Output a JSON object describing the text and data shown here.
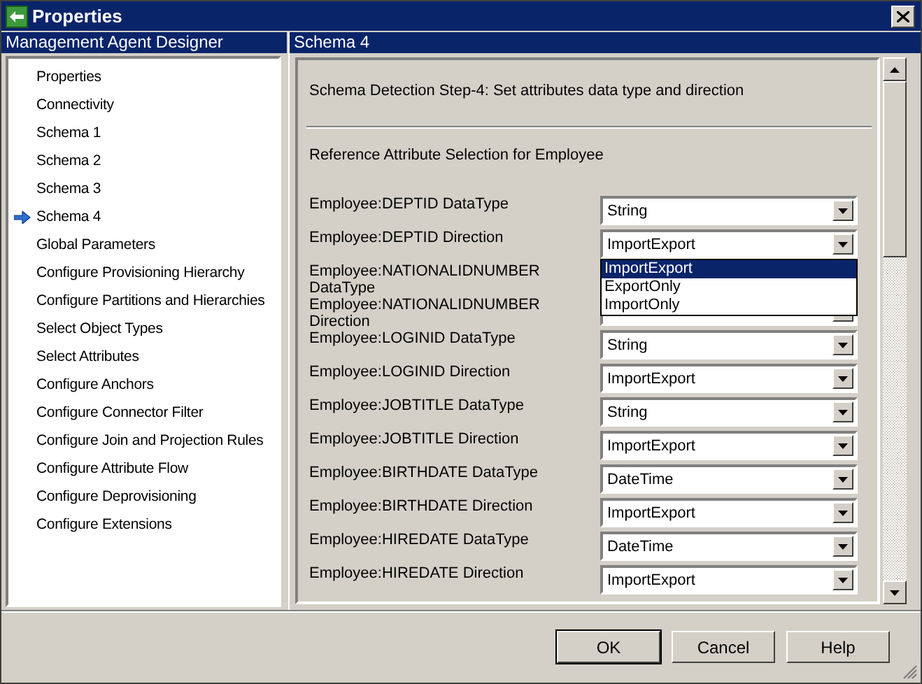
{
  "window": {
    "title": "Properties"
  },
  "sidebar": {
    "header": "Management Agent Designer",
    "items": [
      {
        "label": "Properties",
        "selected": false
      },
      {
        "label": "Connectivity",
        "selected": false
      },
      {
        "label": "Schema 1",
        "selected": false
      },
      {
        "label": "Schema 2",
        "selected": false
      },
      {
        "label": "Schema 3",
        "selected": false
      },
      {
        "label": "Schema 4",
        "selected": true
      },
      {
        "label": "Global Parameters",
        "selected": false
      },
      {
        "label": "Configure Provisioning Hierarchy",
        "selected": false
      },
      {
        "label": "Configure Partitions and Hierarchies",
        "selected": false
      },
      {
        "label": "Select Object Types",
        "selected": false
      },
      {
        "label": "Select Attributes",
        "selected": false
      },
      {
        "label": "Configure Anchors",
        "selected": false
      },
      {
        "label": "Configure Connector Filter",
        "selected": false
      },
      {
        "label": "Configure Join and Projection Rules",
        "selected": false
      },
      {
        "label": "Configure Attribute Flow",
        "selected": false
      },
      {
        "label": "Configure Deprovisioning",
        "selected": false
      },
      {
        "label": "Configure Extensions",
        "selected": false
      }
    ]
  },
  "panel": {
    "header": "Schema 4",
    "description": "Schema Detection Step-4: Set attributes data type and direction",
    "section_title": "Reference Attribute Selection for Employee",
    "rows": [
      {
        "label": "Employee:DEPTID DataType",
        "value": "String",
        "expanded": false
      },
      {
        "label": "Employee:DEPTID Direction",
        "value": "ImportExport",
        "expanded": true,
        "options": [
          {
            "label": "ImportExport",
            "selected": true
          },
          {
            "label": "ExportOnly",
            "selected": false
          },
          {
            "label": "ImportOnly",
            "selected": false
          }
        ]
      },
      {
        "label": "Employee:NATIONALIDNUMBER DataType",
        "expanded": false
      },
      {
        "label": "Employee:NATIONALIDNUMBER Direction",
        "expanded": false
      },
      {
        "label": "Employee:LOGINID DataType",
        "value": "String",
        "expanded": false
      },
      {
        "label": "Employee:LOGINID Direction",
        "value": "ImportExport",
        "expanded": false
      },
      {
        "label": "Employee:JOBTITLE DataType",
        "value": "String",
        "expanded": false
      },
      {
        "label": "Employee:JOBTITLE Direction",
        "value": "ImportExport",
        "expanded": false
      },
      {
        "label": "Employee:BIRTHDATE DataType",
        "value": "DateTime",
        "expanded": false
      },
      {
        "label": "Employee:BIRTHDATE Direction",
        "value": "ImportExport",
        "expanded": false
      },
      {
        "label": "Employee:HIREDATE DataType",
        "value": "DateTime",
        "expanded": false
      },
      {
        "label": "Employee:HIREDATE Direction",
        "value": "ImportExport",
        "expanded": false
      }
    ]
  },
  "buttons": [
    {
      "label": "OK",
      "default": true
    },
    {
      "label": "Cancel",
      "default": false
    },
    {
      "label": "Help",
      "default": false
    }
  ]
}
